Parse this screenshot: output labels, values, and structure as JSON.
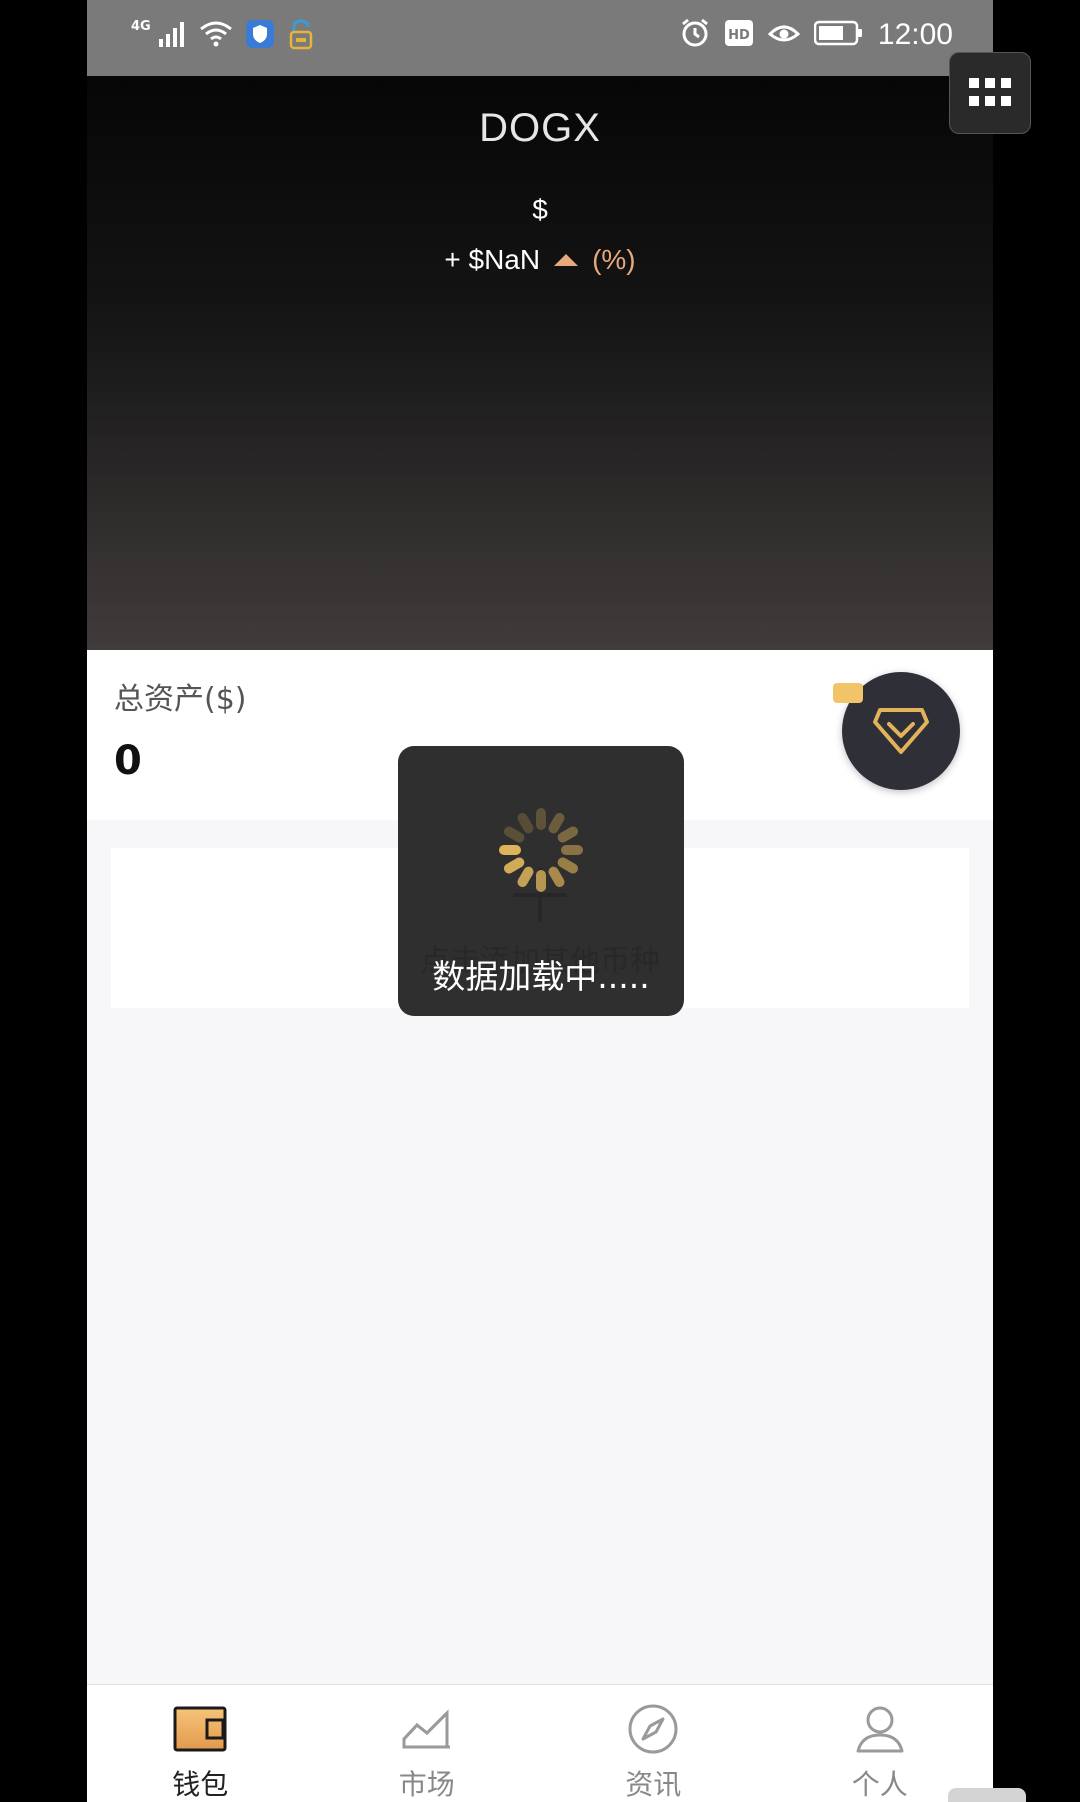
{
  "status_bar": {
    "network_type": "4G",
    "time": "12:00",
    "left_icons": [
      "signal-icon",
      "wifi-icon",
      "shield-icon",
      "lock-icon"
    ],
    "right_icons": [
      "alarm-icon",
      "hd-icon",
      "eye-icon",
      "battery-icon"
    ]
  },
  "header": {
    "title": "DOGX",
    "price": "$",
    "change": "+ $NaN",
    "change_percent": "(%)",
    "accent_color": "#e6a97b"
  },
  "assets": {
    "label": "总资产($)",
    "value": "0"
  },
  "add_currency": {
    "label": "点击添加其他币种"
  },
  "loading": {
    "text": "数据加载中....."
  },
  "tabs": [
    {
      "label": "钱包",
      "icon": "wallet-icon",
      "active": true
    },
    {
      "label": "市场",
      "icon": "market-chart-icon",
      "active": false
    },
    {
      "label": "资讯",
      "icon": "compass-icon",
      "active": false
    },
    {
      "label": "个人",
      "icon": "person-icon",
      "active": false
    }
  ],
  "colors": {
    "gold": "#e3b35a",
    "dark_badge": "#2f2f38"
  }
}
